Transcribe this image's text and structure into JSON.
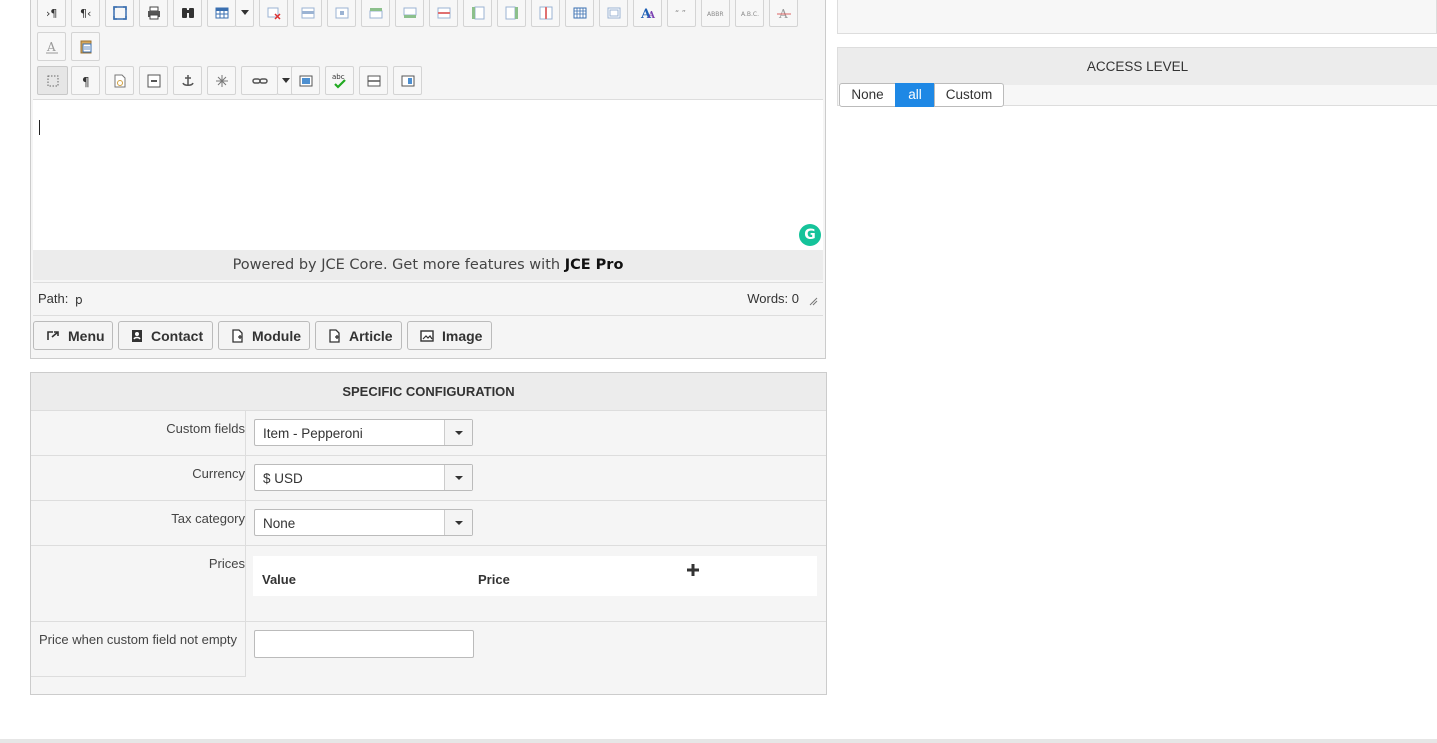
{
  "editor": {
    "powered_prefix": "Powered by JCE Core. Get more features with ",
    "powered_brand": "JCE Pro",
    "path_label": "Path:",
    "path_value": "p",
    "words_label": "Words: 0",
    "toolbar_icons_row1": [
      "visualchars-ltr-icon",
      "visualchars-rtl-icon",
      "fullscreen-icon",
      "print-icon",
      "search-replace-icon",
      "table-icon",
      "delete-table-icon",
      "row-props-icon",
      "cell-props-icon",
      "insert-row-before-icon",
      "insert-row-after-icon",
      "delete-row-icon",
      "insert-col-before-icon",
      "insert-col-after-icon",
      "delete-col-icon",
      "split-cells-icon",
      "merge-cells-icon",
      "styles-icon",
      "blockquote-icon",
      "acronym-icon",
      "abbr-icon",
      "strikethrough-icon"
    ],
    "toolbar_icons_row2": [
      "underline-color-icon",
      "paste-word-icon"
    ],
    "toolbar_icons_row3": [
      "visual-aid-icon",
      "paragraph-icon",
      "template-icon",
      "iframe-icon",
      "anchor-icon",
      "nonbreaking-icon",
      "link-icon",
      "image-icon",
      "spellcheck-icon",
      "horizontal-rule-icon",
      "preview-icon"
    ]
  },
  "extra_buttons": [
    {
      "label": "Menu",
      "icon": "menu-link-icon"
    },
    {
      "label": "Contact",
      "icon": "contact-icon"
    },
    {
      "label": "Module",
      "icon": "module-icon"
    },
    {
      "label": "Article",
      "icon": "article-icon"
    },
    {
      "label": "Image",
      "icon": "image-icon"
    }
  ],
  "specific": {
    "title": "SPECIFIC CONFIGURATION",
    "custom_fields": {
      "label": "Custom fields",
      "value": "Item - Pepperoni"
    },
    "currency": {
      "label": "Currency",
      "value": "$ USD"
    },
    "tax": {
      "label": "Tax category",
      "value": "None"
    },
    "prices": {
      "label": "Prices",
      "col_value": "Value",
      "col_price": "Price"
    },
    "custom_empty": {
      "label": "Price when custom field not empty",
      "value": ""
    }
  },
  "access": {
    "title": "ACCESS LEVEL",
    "options": [
      "None",
      "all",
      "Custom"
    ],
    "selected": "all"
  },
  "colors": {
    "accent": "#1e88e5",
    "grammarly": "#15c39a"
  }
}
